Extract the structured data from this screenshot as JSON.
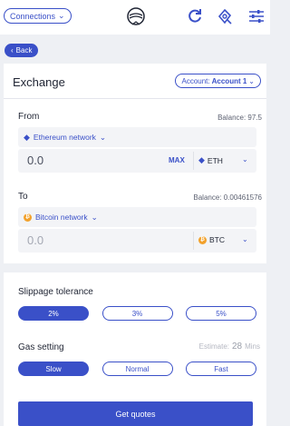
{
  "header": {
    "connections_label": "Connections",
    "icons": [
      "logo-icon",
      "refresh-icon",
      "gas-icon",
      "settings-icon"
    ]
  },
  "back_label": "Back",
  "exchange": {
    "title": "Exchange",
    "account_prefix": "Account:",
    "account_name": "Account 1",
    "from": {
      "label": "From",
      "balance": "Balance: 97.5",
      "network": "Ethereum network",
      "amount": "0.0",
      "max_label": "MAX",
      "token": "ETH"
    },
    "to": {
      "label": "To",
      "balance": "Balance: 0.00461576",
      "network": "Bitcoin network",
      "amount": "0.0",
      "token": "BTC"
    }
  },
  "slippage": {
    "label": "Slippage tolerance",
    "options": [
      "2%",
      "3%",
      "5%"
    ],
    "selected": "2%"
  },
  "gas": {
    "label": "Gas setting",
    "estimate_label": "Estimate:",
    "estimate_value": "28",
    "estimate_unit": "Mins",
    "options": [
      "Slow",
      "Normal",
      "Fast"
    ],
    "selected": "Slow"
  },
  "get_quotes_label": "Get quotes",
  "colors": {
    "accent": "#3a50c8",
    "bitcoin": "#f2a12c",
    "background": "#eef0f4"
  }
}
